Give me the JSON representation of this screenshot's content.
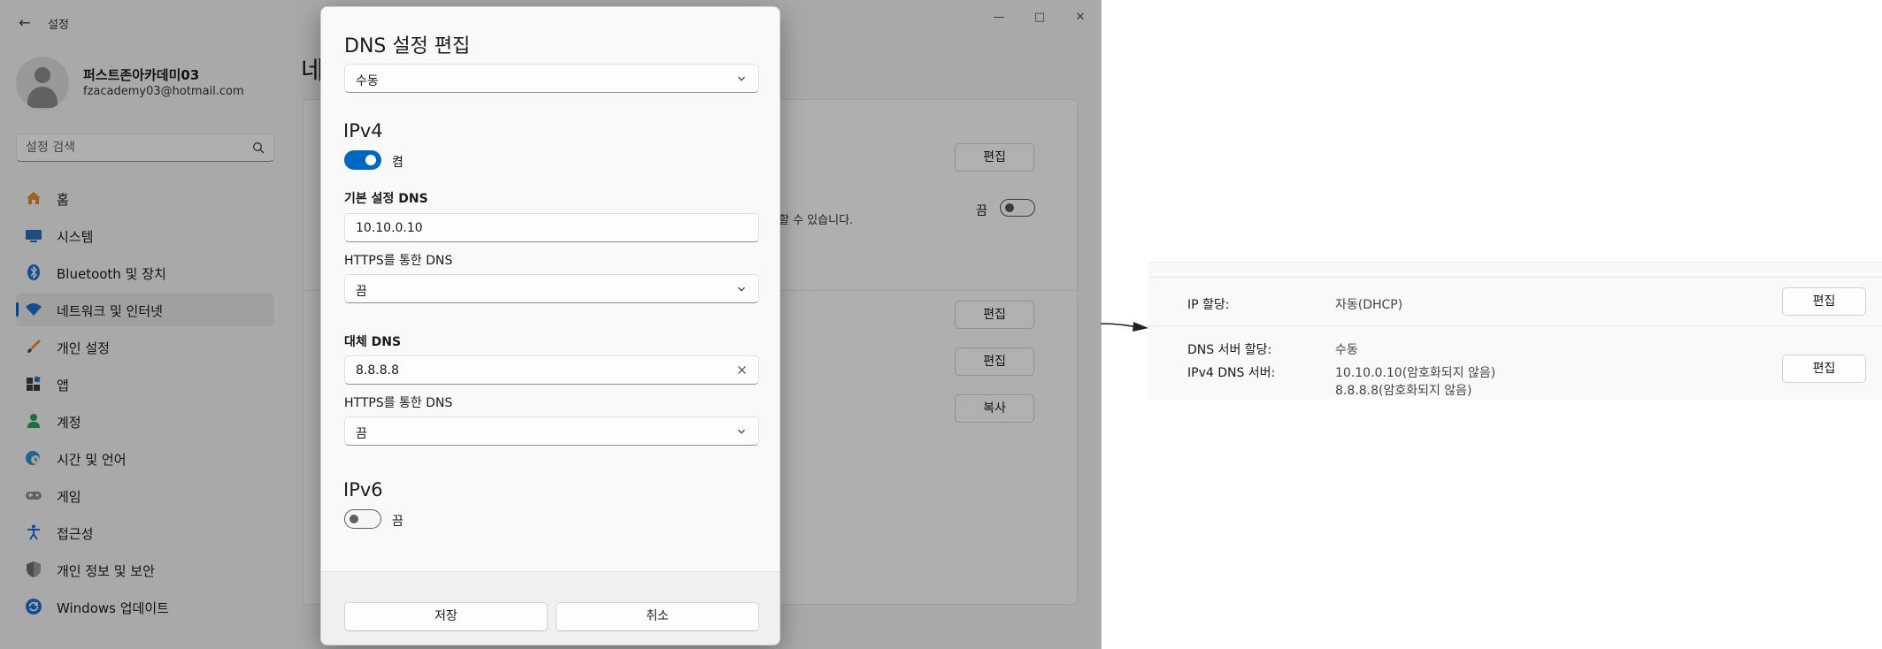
{
  "window": {
    "back_icon": "back-arrow-icon",
    "title": "설정",
    "controls": [
      "minimize-icon",
      "maximize-icon",
      "close-icon"
    ]
  },
  "profile": {
    "name": "퍼스트존아카데미03",
    "email": "fzacademy03@hotmail.com"
  },
  "search": {
    "placeholder": "설정 검색",
    "icon": "search-icon"
  },
  "sidebar": {
    "selected_index": 3,
    "accent_color": "#0067c0",
    "items": [
      {
        "label": "홈",
        "icon": "home-icon"
      },
      {
        "label": "시스템",
        "icon": "monitor-icon"
      },
      {
        "label": "Bluetooth 및 장치",
        "icon": "bluetooth-icon"
      },
      {
        "label": "네트워크 및 인터넷",
        "icon": "wifi-icon"
      },
      {
        "label": "개인 설정",
        "icon": "brush-icon"
      },
      {
        "label": "앱",
        "icon": "apps-icon"
      },
      {
        "label": "계정",
        "icon": "person-icon"
      },
      {
        "label": "시간 및 언어",
        "icon": "globe-clock-icon"
      },
      {
        "label": "게임",
        "icon": "gamepad-icon"
      },
      {
        "label": "접근성",
        "icon": "accessibility-icon"
      },
      {
        "label": "개인 정보 및 보안",
        "icon": "shield-icon"
      },
      {
        "label": "Windows 업데이트",
        "icon": "update-icon"
      }
    ]
  },
  "background": {
    "heading_partial": "네",
    "edit_label": "편집",
    "copy_label": "복사",
    "off_label": "끔",
    "partial_text": "할 수 있습니다."
  },
  "dialog": {
    "title": "DNS 설정 편집",
    "mode": "수동",
    "ipv4": {
      "title": "IPv4",
      "toggle_state": "켬",
      "enabled": true,
      "preferred_label": "기본 설정 DNS",
      "preferred_value": "10.10.0.10",
      "preferred_doh_label": "HTTPS를 통한 DNS",
      "preferred_doh_value": "끔",
      "alternate_label": "대체 DNS",
      "alternate_value": "8.8.8.8",
      "alternate_doh_label": "HTTPS를 통한 DNS",
      "alternate_doh_value": "끔"
    },
    "ipv6": {
      "title": "IPv6",
      "toggle_state": "끔",
      "enabled": false
    },
    "save_label": "저장",
    "cancel_label": "취소"
  },
  "result": {
    "ip_assign_label": "IP 할당:",
    "ip_assign_value": "자동(DHCP)",
    "dns_assign_label": "DNS 서버 할당:",
    "dns_assign_value": "수동",
    "ipv4_dns_label": "IPv4 DNS 서버:",
    "ipv4_dns_value_1": "10.10.0.10(암호화되지 않음)",
    "ipv4_dns_value_2": "8.8.8.8(암호화되지 않음)",
    "edit_label": "편집"
  }
}
